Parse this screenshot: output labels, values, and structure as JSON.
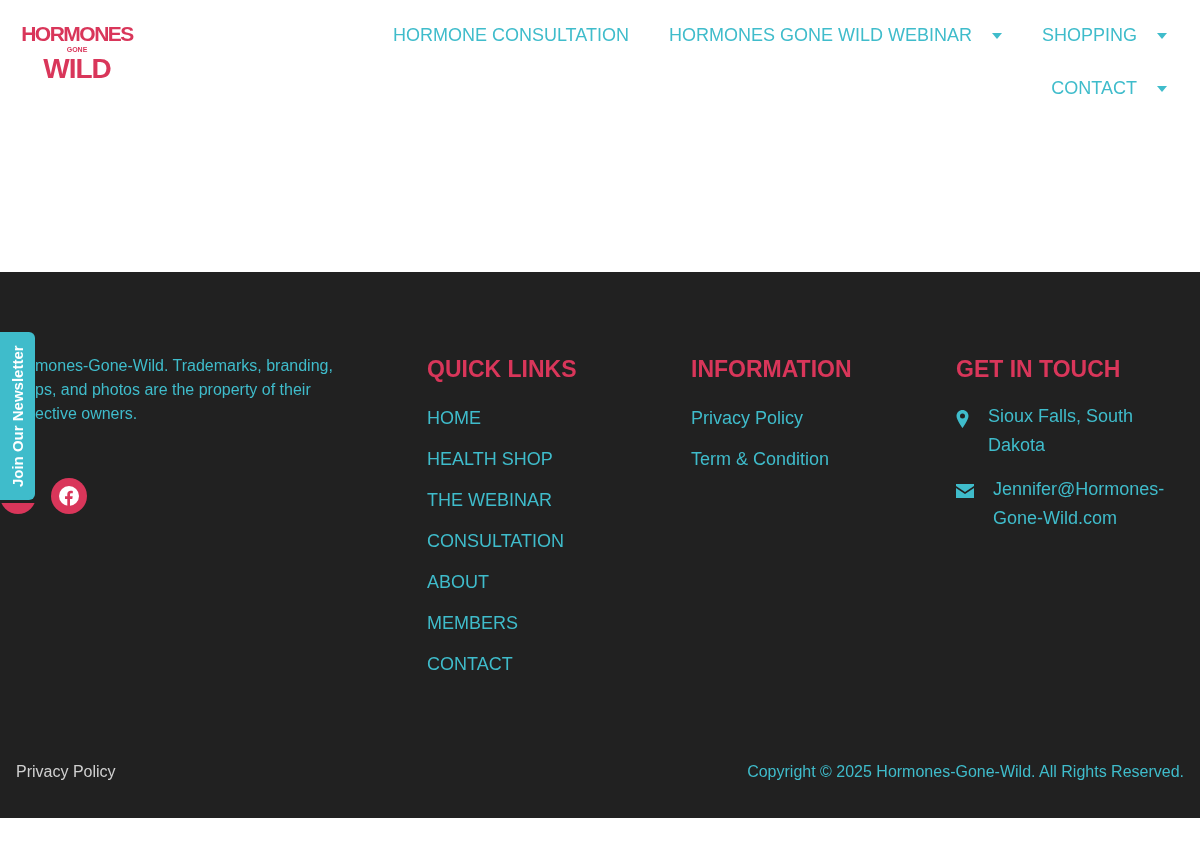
{
  "logo": {
    "line_1": "HORMONES",
    "line_2": "GONE",
    "line_3": "WILD"
  },
  "nav": [
    {
      "label": "HORMONE CONSULTATION",
      "dropdown": false
    },
    {
      "label": "HORMONES GONE WILD WEBINAR",
      "dropdown": true
    },
    {
      "label": "SHOPPING",
      "dropdown": true
    },
    {
      "label": "CONTACT",
      "dropdown": true
    }
  ],
  "footer": {
    "about_lines": [
      "mones-Gone-Wild. Trademarks, branding,",
      "ps, and photos are the property of their",
      "ective owners."
    ],
    "quick_links": {
      "title": "QUICK LINKS",
      "items": [
        "HOME",
        "HEALTH SHOP",
        "THE WEBINAR",
        "CONSULTATION",
        "ABOUT",
        "MEMBERS",
        "CONTACT"
      ]
    },
    "information": {
      "title": "INFORMATION",
      "items": [
        "Privacy Policy",
        "Term & Condition"
      ]
    },
    "get_in_touch": {
      "title": "GET IN TOUCH",
      "items": [
        {
          "kind": "location",
          "text": "Sioux Falls, South Dakota"
        },
        {
          "kind": "email",
          "text": "Jennifer@Hormones-Gone-Wild.com"
        }
      ]
    },
    "bottom_left": "Privacy Policy",
    "copyright": "Copyright © 2025 Hormones-Gone-Wild. All Rights Reserved."
  },
  "newsletter_tab": "Join Our Newsletter"
}
